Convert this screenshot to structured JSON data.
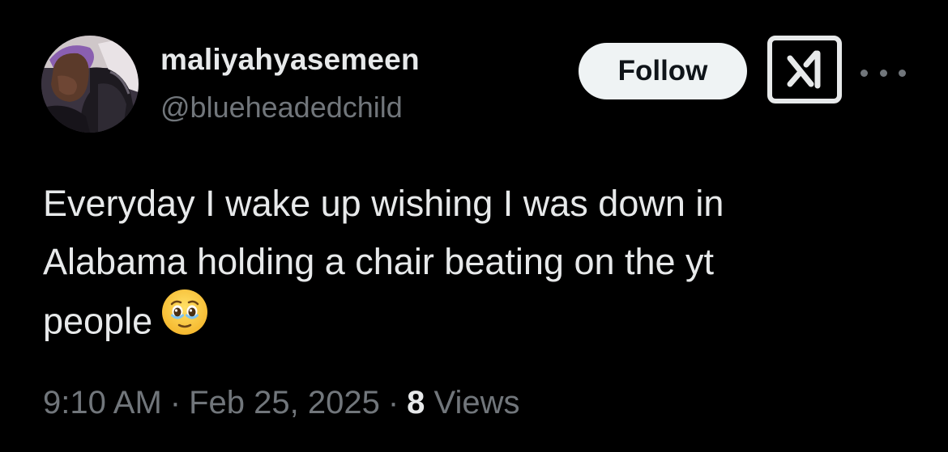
{
  "user": {
    "display_name": "maliyahyasemeen",
    "handle": "@blueheadedchild",
    "avatar_icon": "profile-photo"
  },
  "actions": {
    "follow_label": "Follow",
    "grok_icon": "grok-icon",
    "more_icon": "more-horizontal-icon"
  },
  "tweet": {
    "line1": "Everyday I wake up wishing I was down in",
    "line2": "Alabama holding a chair beating on the yt",
    "line3": "people",
    "emoji_icon": "face-holding-back-tears-emoji"
  },
  "meta": {
    "time": "9:10 AM",
    "date": "Feb 25, 2025",
    "views_count": "8",
    "views_label": "Views",
    "separator": "·"
  },
  "colors": {
    "background": "#000000",
    "primary_text": "#e7e9ea",
    "secondary_text": "#71767b",
    "follow_bg": "#eff3f4"
  }
}
